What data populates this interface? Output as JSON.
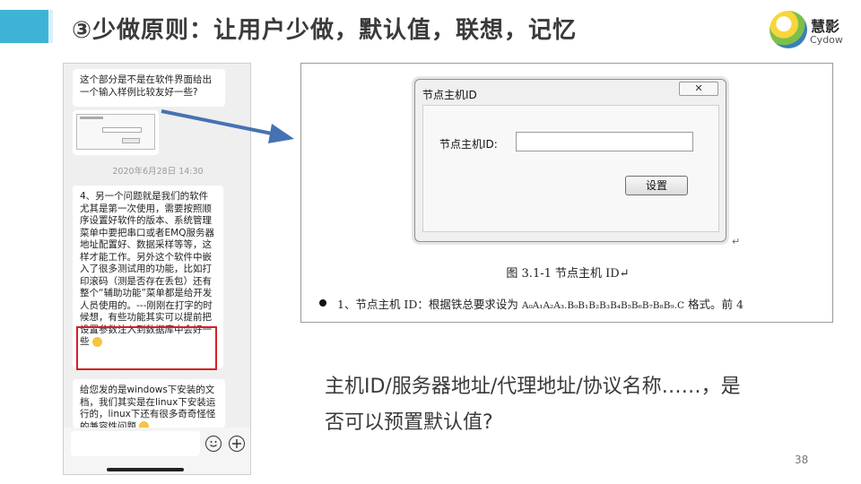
{
  "slide": {
    "title": "③少做原则：让用户少做，默认值，联想，记忆",
    "page_number": "38",
    "accent_color": "#3fb3d6",
    "logo": {
      "name": "慧影",
      "subtitle": "Cydow"
    }
  },
  "chat": {
    "messages": [
      {
        "text": "这个部分是不是在软件界面给出一个输入样例比较友好一些?"
      },
      {
        "text": "2020年6月28日 14:30",
        "kind": "timestamp"
      },
      {
        "text": "4、另一个问题就是我们的软件尤其是第一次使用，需要按照顺序设置好软件的版本、系统管理菜单中要把串口或者EMQ服务器地址配置好、数据采样等等，这样才能工作。另外这个软件中嵌入了很多测试用的功能，比如打印滚码（测是否存在丢包）还有整个“辅助功能”菜单都是给开发人员使用的。---刚刚在打字的时候想，有些功能其实可以提前把设置参数注入到数据库中会好一些"
      },
      {
        "text": "给您发的是windows下安装的文档，我们其实是在linux下安装运行的，linux下还有很多奇奇怪怪的兼容性问题"
      }
    ],
    "highlight_color": "#d41f26",
    "input_placeholder": ""
  },
  "dialog": {
    "title": "节点主机ID",
    "close_label": "✕",
    "field_label": "节点主机ID:",
    "field_value": "",
    "button_label": "设置"
  },
  "document": {
    "return_mark": "↵",
    "caption": "图 3.1-1  节点主机 ID↵",
    "bullet_text": "1、节点主机 ID：根据铁总要求设为 ",
    "bullet_format": "A₀A₁A₂A₃.B₀B₁B₂B₃B₄B₅B₆B₇B₈B₉.C",
    "bullet_tail": " 格式。前 4"
  },
  "question": {
    "line1": "主机ID/服务器地址/代理地址/协议名称……，是",
    "line2": "否可以预置默认值?"
  }
}
